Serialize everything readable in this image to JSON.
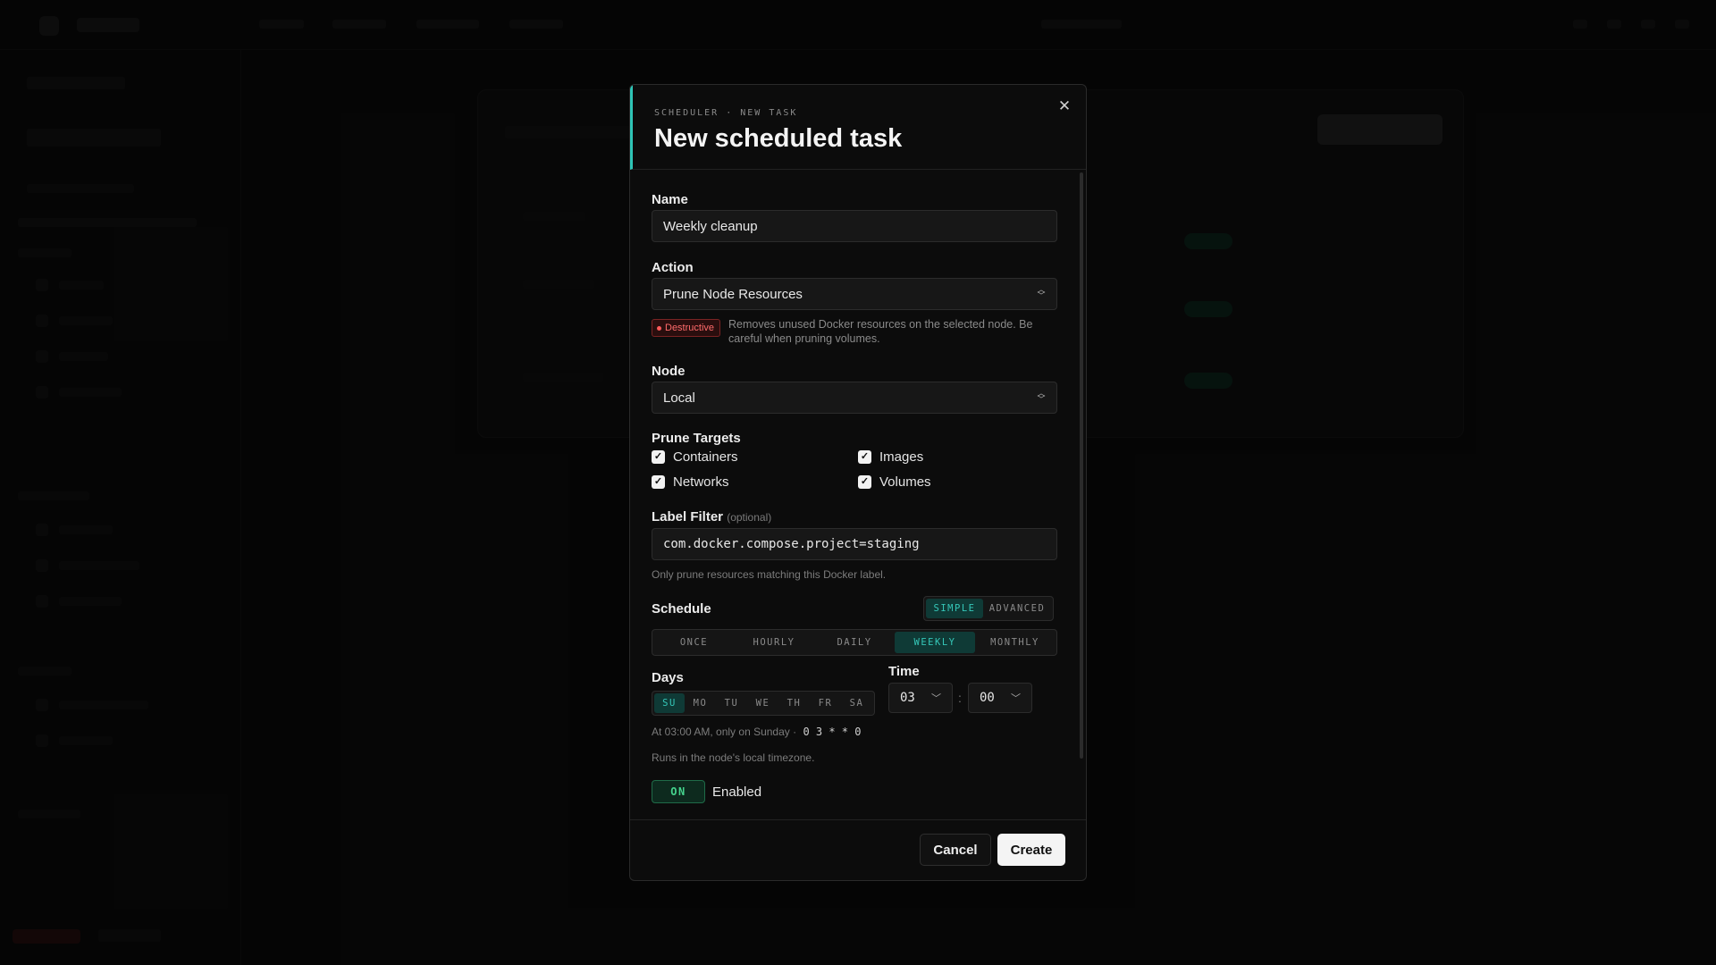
{
  "modal": {
    "eyebrow": "SCHEDULER · NEW TASK",
    "title": "New scheduled task",
    "close_icon": "close-icon"
  },
  "form": {
    "name_label": "Name",
    "name_value": "Weekly cleanup",
    "action_label": "Action",
    "action_value": "Prune Node Resources",
    "destructive_badge": "Destructive",
    "action_description": "Removes unused Docker resources on the selected node. Be careful when pruning volumes.",
    "node_label": "Node",
    "node_value": "Local",
    "prune_targets_label": "Prune Targets",
    "targets": [
      {
        "label": "Containers",
        "checked": true
      },
      {
        "label": "Images",
        "checked": true
      },
      {
        "label": "Networks",
        "checked": true
      },
      {
        "label": "Volumes",
        "checked": true
      }
    ],
    "label_filter_label": "Label Filter",
    "label_filter_optional": "(optional)",
    "label_filter_value": "com.docker.compose.project=staging",
    "label_filter_hint": "Only prune resources matching this Docker label.",
    "schedule_label": "Schedule",
    "schedule_modes": [
      "SIMPLE",
      "ADVANCED"
    ],
    "schedule_mode_selected": "SIMPLE",
    "frequencies": [
      "ONCE",
      "HOURLY",
      "DAILY",
      "WEEKLY",
      "MONTHLY"
    ],
    "frequency_selected": "WEEKLY",
    "days_label": "Days",
    "days": [
      "SU",
      "MO",
      "TU",
      "WE",
      "TH",
      "FR",
      "SA"
    ],
    "days_selected": [
      "SU"
    ],
    "time_label": "Time",
    "time_hour": "03",
    "time_separator": ":",
    "time_minute": "00",
    "schedule_summary": "At 03:00 AM, only on Sunday ·",
    "cron_expression": "0 3 * * 0",
    "timezone_hint": "Runs in the node's local timezone.",
    "enabled_toggle": "ON",
    "enabled_label": "Enabled"
  },
  "footer": {
    "cancel_label": "Cancel",
    "create_label": "Create"
  },
  "colors": {
    "accent": "#2ec4b6",
    "destructive": "#ff6b6b",
    "enabled": "#45d38d"
  }
}
